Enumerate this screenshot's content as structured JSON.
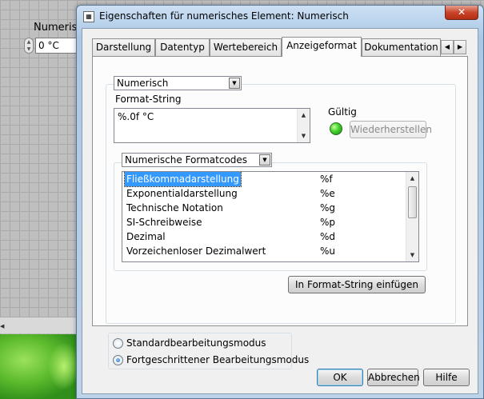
{
  "background": {
    "control_label": "Numerisch",
    "control_value": "0 °C"
  },
  "window": {
    "title": "Eigenschaften für numerisches Element: Numerisch",
    "close_glyph": "✕"
  },
  "tabs": [
    {
      "label": "Darstellung",
      "active": false
    },
    {
      "label": "Datentyp",
      "active": false
    },
    {
      "label": "Wertebereich",
      "active": false
    },
    {
      "label": "Anzeigeformat",
      "active": true
    },
    {
      "label": "Dokumentation",
      "active": false
    }
  ],
  "format": {
    "type_select": "Numerisch",
    "format_string_label": "Format-String",
    "format_string_value": "%.0f °C",
    "valid_label": "Gültig",
    "restore_button": "Wiederherstellen",
    "codes_select": "Numerische Formatcodes",
    "codes": [
      {
        "name": "Fließkommadarstellung",
        "code": "%f",
        "selected": true
      },
      {
        "name": "Exponentialdarstellung",
        "code": "%e",
        "selected": false
      },
      {
        "name": "Technische Notation",
        "code": "%g",
        "selected": false
      },
      {
        "name": "SI-Schreibweise",
        "code": "%p",
        "selected": false
      },
      {
        "name": "Dezimal",
        "code": "%d",
        "selected": false
      },
      {
        "name": "Vorzeichenloser Dezimalwert",
        "code": "%u",
        "selected": false
      }
    ],
    "insert_button": "In Format-String einfügen"
  },
  "mode": {
    "options": [
      {
        "label": "Standardbearbeitungsmodus",
        "checked": false
      },
      {
        "label": "Fortgeschrittener Bearbeitungsmodus",
        "checked": true
      }
    ]
  },
  "footer": {
    "ok": "OK",
    "cancel": "Abbrechen",
    "help": "Hilfe"
  },
  "colors": {
    "selection": "#3399ff",
    "led_valid": "#3fd12a",
    "title_gradient": "#aac8e6"
  }
}
